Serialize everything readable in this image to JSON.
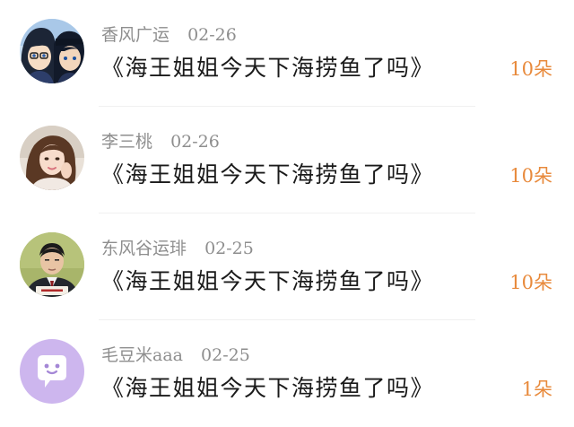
{
  "comments": [
    {
      "username": "香风广运",
      "date": "02-26",
      "title": "《海王姐姐今天下海捞鱼了吗》",
      "count": "10朵",
      "avatar": "anime-character-avatar"
    },
    {
      "username": "李三桃",
      "date": "02-26",
      "title": "《海王姐姐今天下海捞鱼了吗》",
      "count": "10朵",
      "avatar": "woman-portrait-avatar"
    },
    {
      "username": "东风谷运琲",
      "date": "02-25",
      "title": "《海王姐姐今天下海捞鱼了吗》",
      "count": "10朵",
      "avatar": "man-in-suit-avatar"
    },
    {
      "username": "毛豆米aaa",
      "date": "02-25",
      "title": "《海王姐姐今天下海捞鱼了吗》",
      "count": "1朵",
      "avatar": "default-chat-bubble-avatar"
    }
  ],
  "colors": {
    "meta": "#8e8e8e",
    "title": "#1a1a1a",
    "count": "#e88a3c",
    "default_avatar_bg": "#cdb6ee"
  }
}
